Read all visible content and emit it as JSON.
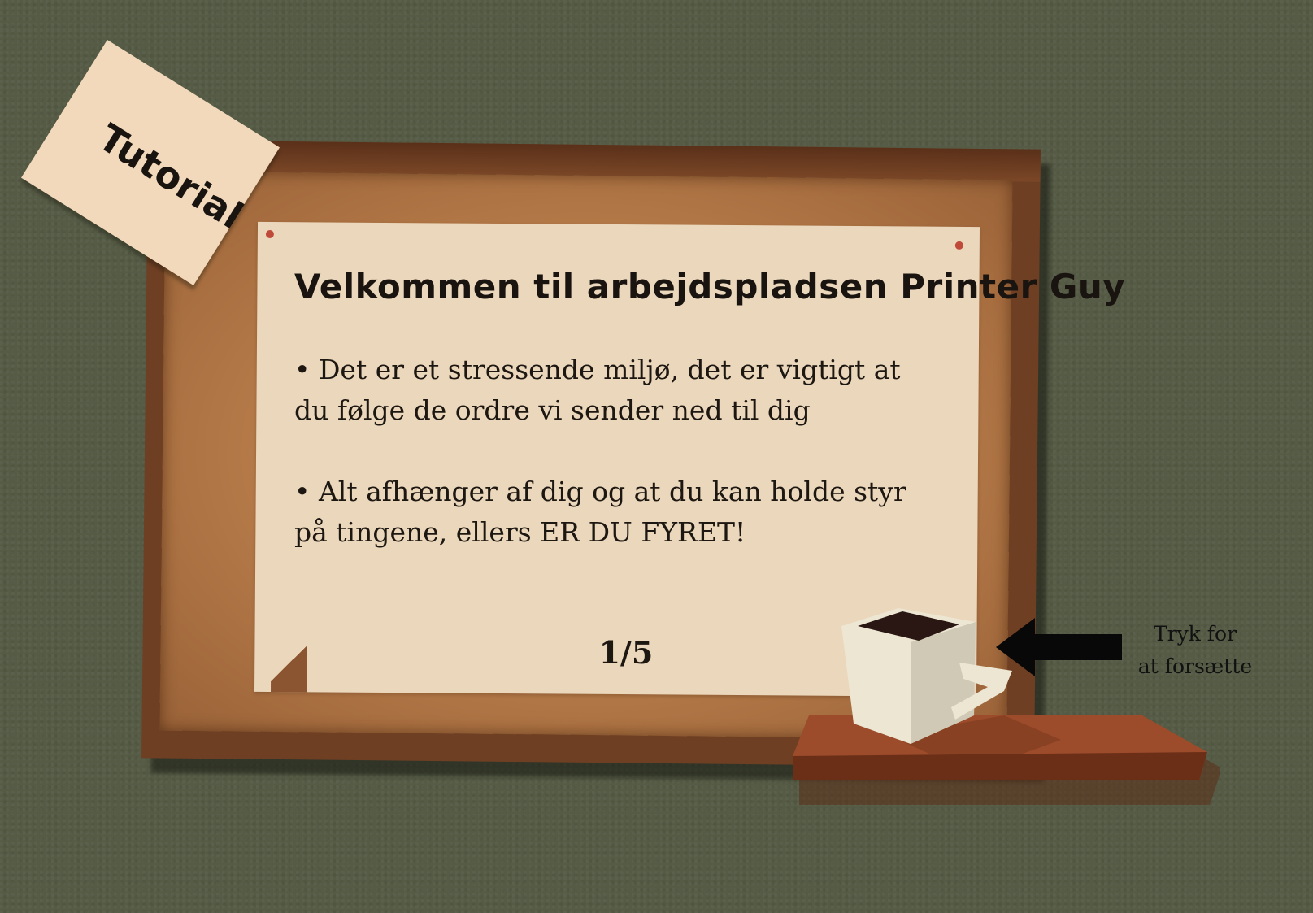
{
  "note": {
    "label": "Tutorial"
  },
  "paper": {
    "title": "Velkommen til arbejdspladsen Printer Guy",
    "bullets": [
      "• Det er et stressende miljø, det er vigtigt at du følge de ordre vi sender ned til dig",
      "• Alt afhænger af dig og at du kan holde styr på tingene, ellers ER DU FYRET!"
    ],
    "page_indicator": "1/5"
  },
  "hint": {
    "line1": "Tryk for",
    "line2": "at forsætte"
  },
  "colors": {
    "wall": "#555b45",
    "frame": "#6e3f23",
    "paper": "#ebd7bb",
    "note": "#f3d9bb",
    "text": "#1d1712"
  },
  "icons": {
    "cup": "coffee-cup-icon",
    "arrow": "left-arrow-icon"
  }
}
